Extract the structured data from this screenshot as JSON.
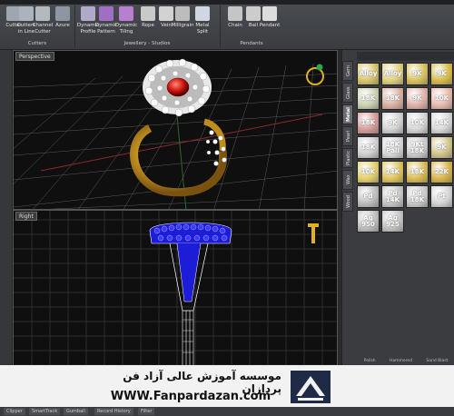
{
  "ribbon": {
    "groups": [
      {
        "label": "Cutters"
      },
      {
        "label": "Jewellery - Studios"
      },
      {
        "label": "Pendants"
      }
    ],
    "tools": [
      {
        "label": "Cutter",
        "color": "#9fa6b0"
      },
      {
        "label": "Cutters in Line",
        "color": "#aab3be"
      },
      {
        "label": "Channel Cutter",
        "color": "#b5b8bd"
      },
      {
        "label": "Azure",
        "color": "#8f96a3"
      },
      {
        "label": "Dynamic Profile",
        "color": "#b0a9c9"
      },
      {
        "label": "Dynamic Pattern",
        "color": "#9e6fc5"
      },
      {
        "label": "Dynamic Tiling",
        "color": "#b87ed0"
      },
      {
        "label": "Rope",
        "color": "#c9c9c9"
      },
      {
        "label": "Vein",
        "color": "#d2d2d2"
      },
      {
        "label": "Milligrain",
        "color": "#bcbcbc"
      },
      {
        "label": "Metal Split",
        "color": "#d0d6e2"
      },
      {
        "label": "Chain",
        "color": "#c5c5c5"
      },
      {
        "label": "Bail",
        "color": "#cccccc"
      },
      {
        "label": "Pendant",
        "color": "#dcdcdc"
      }
    ]
  },
  "viewports": {
    "top": {
      "label": "Perspective"
    },
    "bottom": {
      "label": "Right"
    }
  },
  "panel": {
    "tabs": [
      "Gem",
      "Glass",
      "Metal",
      "Pearl",
      "Plastic",
      "Wax",
      "Wood"
    ],
    "active_tab": "Metal",
    "swatches": [
      {
        "label": "Alloy",
        "color": "#d8c46a"
      },
      {
        "label": "Alloy",
        "color": "#e0cf7d"
      },
      {
        "label": "9K",
        "color": "#d8c05a"
      },
      {
        "label": "9K",
        "color": "#d6ba48"
      },
      {
        "label": "18K",
        "color": "#c9d1b0"
      },
      {
        "label": "18K",
        "color": "#d8b1a3"
      },
      {
        "label": "9K",
        "color": "#e0b2a8"
      },
      {
        "label": "10K",
        "color": "#e8b9ac"
      },
      {
        "label": "18K",
        "color": "#d39b98"
      },
      {
        "label": "9K",
        "color": "#d1d1d1"
      },
      {
        "label": "10K",
        "color": "#d5d5d5"
      },
      {
        "label": "14K",
        "color": "#d7d7d7"
      },
      {
        "label": "18K",
        "color": "#cfcfcf"
      },
      {
        "label": "18K Pall",
        "color": "#d9d9d9"
      },
      {
        "label": "9Kt 18K",
        "color": "#cdcdcd"
      },
      {
        "label": "9K",
        "color": "#d0c48a"
      },
      {
        "label": "10K",
        "color": "#e3cf6a"
      },
      {
        "label": "14K",
        "color": "#dfc35c"
      },
      {
        "label": "18K",
        "color": "#dabb51"
      },
      {
        "label": "22K",
        "color": "#d9b447"
      },
      {
        "label": "Pd",
        "color": "#bdbdbd"
      },
      {
        "label": "Pd 14K",
        "color": "#c6c6c6"
      },
      {
        "label": "Pd 18K",
        "color": "#cacaca"
      },
      {
        "label": "Pt",
        "color": "#d4d4d4"
      },
      {
        "label": "Ag 950",
        "color": "#bfbfbf"
      },
      {
        "label": "Ag 925",
        "color": "#c4c4c4"
      }
    ],
    "bottom_labels": [
      "Polish",
      "Hammered",
      "Sand Blast"
    ]
  },
  "banner": {
    "title": "موسسه آموزش عالی آزاد فن پردازان",
    "url": "WWW.Fanpardazan.com"
  },
  "statusbar": {
    "tabs": [
      "Clipper",
      "SmartTrack",
      "Gumball",
      "Record History",
      "Filter"
    ]
  }
}
